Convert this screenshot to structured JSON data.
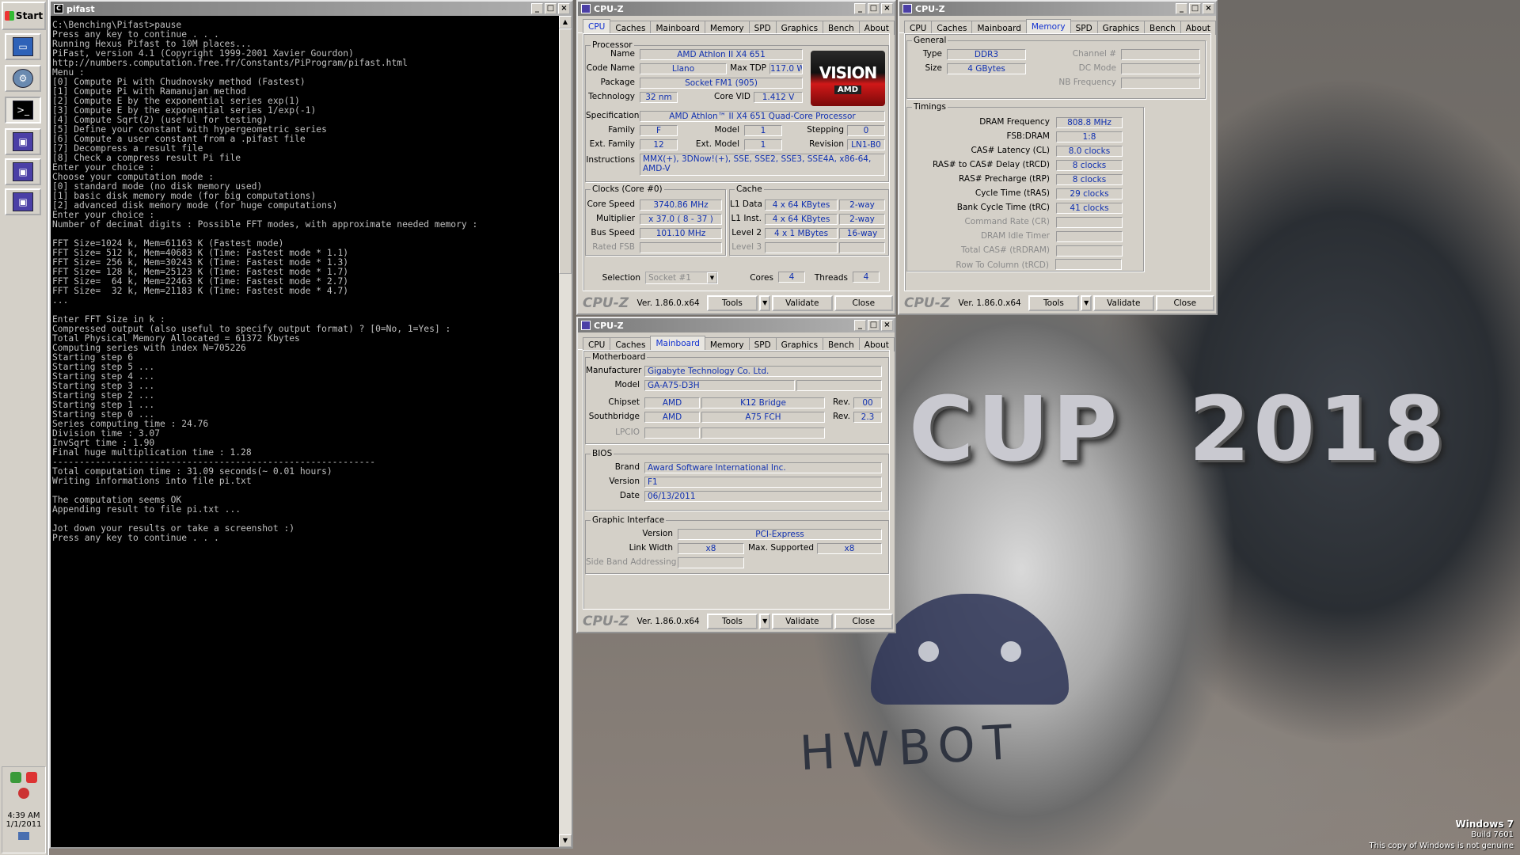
{
  "desktop": {
    "cup_text": "CUP  2018",
    "hwbot_text": "HWBOT",
    "os_name": "Windows 7",
    "os_build": "Build 7601",
    "os_notice": "This copy of Windows is not genuine"
  },
  "taskbar": {
    "start_label": "Start",
    "clock_time": "4:39 AM",
    "clock_date": "1/1/2011"
  },
  "console": {
    "title": "pifast",
    "lines": [
      "C:\\Benching\\Pifast>pause",
      "Press any key to continue . . .",
      "Running Hexus Pifast to 10M places...",
      "PiFast, version 4.1 (Copyright 1999-2001 Xavier Gourdon)",
      "http://numbers.computation.free.fr/Constants/PiProgram/pifast.html",
      "Menu :",
      "[0] Compute Pi with Chudnovsky method (Fastest)",
      "[1] Compute Pi with Ramanujan method",
      "[2] Compute E by the exponential series exp(1)",
      "[3] Compute E by the exponential series 1/exp(-1)",
      "[4] Compute Sqrt(2) (useful for testing)",
      "[5] Define your constant with hypergeometric series",
      "[6] Compute a user constant from a .pifast file",
      "[7] Decompress a result file",
      "[8] Check a compress result Pi file",
      "Enter your choice :",
      "Choose your computation mode :",
      "[0] standard mode (no disk memory used)",
      "[1] basic disk memory mode (for big computations)",
      "[2] advanced disk memory mode (for huge computations)",
      "Enter your choice :",
      "Number of decimal digits : Possible FFT modes, with approximate needed memory :",
      "",
      "FFT Size=1024 k, Mem=61163 K (Fastest mode)",
      "FFT Size= 512 k, Mem=40683 K (Time: Fastest mode * 1.1)",
      "FFT Size= 256 k, Mem=30243 K (Time: Fastest mode * 1.3)",
      "FFT Size= 128 k, Mem=25123 K (Time: Fastest mode * 1.7)",
      "FFT Size=  64 k, Mem=22463 K (Time: Fastest mode * 2.7)",
      "FFT Size=  32 k, Mem=21183 K (Time: Fastest mode * 4.7)",
      "...",
      "",
      "Enter FFT Size in k :",
      "Compressed output (also useful to specify output format) ? [0=No, 1=Yes] :",
      "Total Physical Memory Allocated = 61372 Kbytes",
      "Computing series with index N=705226",
      "Starting step 6",
      "Starting step 5 ...",
      "Starting step 4 ...",
      "Starting step 3 ...",
      "Starting step 2 ...",
      "Starting step 1 ...",
      "Starting step 0 ...",
      "Series computing time : 24.76",
      "Division time : 3.07",
      "InvSqrt time : 1.90",
      "Final huge multiplication time : 1.28",
      "------------------------------------------------------------",
      "Total computation time : 31.09 seconds(~ 0.01 hours)",
      "Writing informations into file pi.txt",
      "",
      "The computation seems OK",
      "Appending result to file pi.txt ...",
      "",
      "Jot down your results or take a screenshot :)",
      "Press any key to continue . . ."
    ]
  },
  "cpuz_common": {
    "title": "CPU-Z",
    "tabs": [
      "CPU",
      "Caches",
      "Mainboard",
      "Memory",
      "SPD",
      "Graphics",
      "Bench",
      "About"
    ],
    "logo": "CPU-Z",
    "version": "Ver. 1.86.0.x64",
    "tools": "Tools",
    "validate": "Validate",
    "close": "Close"
  },
  "cpu": {
    "group_processor": "Processor",
    "name_label": "Name",
    "name": "AMD Athlon II X4 651",
    "codename_label": "Code Name",
    "codename": "Llano",
    "maxtdp_label": "Max TDP",
    "maxtdp": "117.0 W",
    "package_label": "Package",
    "package": "Socket FM1 (905)",
    "technology_label": "Technology",
    "technology": "32 nm",
    "corevid_label": "Core VID",
    "corevid": "1.412 V",
    "spec_label": "Specification",
    "spec": "AMD Athlon™ II X4 651 Quad-Core Processor",
    "family_label": "Family",
    "family": "F",
    "model_label": "Model",
    "model": "1",
    "stepping_label": "Stepping",
    "stepping": "0",
    "extfamily_label": "Ext. Family",
    "extfamily": "12",
    "extmodel_label": "Ext. Model",
    "extmodel": "1",
    "revision_label": "Revision",
    "revision": "LN1-B0",
    "instr_label": "Instructions",
    "instr": "MMX(+), 3DNow!(+), SSE, SSE2, SSE3, SSE4A, x86-64, AMD-V",
    "badge_top": "VISION",
    "badge_bottom": "AMD",
    "group_clocks": "Clocks (Core #0)",
    "corespeed_label": "Core Speed",
    "corespeed": "3740.86 MHz",
    "multiplier_label": "Multiplier",
    "multiplier": "x 37.0 ( 8 - 37 )",
    "busspeed_label": "Bus Speed",
    "busspeed": "101.10 MHz",
    "ratedfsb_label": "Rated FSB",
    "group_cache": "Cache",
    "l1d_label": "L1 Data",
    "l1d": "4 x 64 KBytes",
    "l1d_way": "2-way",
    "l1i_label": "L1 Inst.",
    "l1i": "4 x 64 KBytes",
    "l1i_way": "2-way",
    "l2_label": "Level 2",
    "l2": "4 x 1 MBytes",
    "l2_way": "16-way",
    "l3_label": "Level 3",
    "selection_label": "Selection",
    "selection": "Socket #1",
    "cores_label": "Cores",
    "cores": "4",
    "threads_label": "Threads",
    "threads": "4"
  },
  "memory": {
    "group_general": "General",
    "type_label": "Type",
    "type": "DDR3",
    "size_label": "Size",
    "size": "4 GBytes",
    "channel_label": "Channel #",
    "dcmode_label": "DC Mode",
    "nbfreq_label": "NB Frequency",
    "group_timings": "Timings",
    "dram_label": "DRAM Frequency",
    "dram": "808.8 MHz",
    "fsbdram_label": "FSB:DRAM",
    "fsbdram": "1:8",
    "cl_label": "CAS# Latency (CL)",
    "cl": "8.0 clocks",
    "trcd_label": "RAS# to CAS# Delay (tRCD)",
    "trcd": "8 clocks",
    "trp_label": "RAS# Precharge (tRP)",
    "trp": "8 clocks",
    "tras_label": "Cycle Time (tRAS)",
    "tras": "29 clocks",
    "trc_label": "Bank Cycle Time (tRC)",
    "trc": "41 clocks",
    "cr_label": "Command Rate (CR)",
    "idle_label": "DRAM Idle Timer",
    "trdram_label": "Total CAS# (tRDRAM)",
    "trcd2_label": "Row To Column (tRCD)"
  },
  "mainboard": {
    "group_mb": "Motherboard",
    "manu_label": "Manufacturer",
    "manu": "Gigabyte Technology Co. Ltd.",
    "model_label": "Model",
    "model": "GA-A75-D3H",
    "chipset_label": "Chipset",
    "chipset_vendor": "AMD",
    "chipset_name": "K12 Bridge",
    "rev_label": "Rev.",
    "chipset_rev": "00",
    "south_label": "Southbridge",
    "south_vendor": "AMD",
    "south_name": "A75 FCH",
    "south_rev": "2.3",
    "lpcio_label": "LPCIO",
    "group_bios": "BIOS",
    "brand_label": "Brand",
    "brand": "Award Software International Inc.",
    "version_label": "Version",
    "version": "F1",
    "date_label": "Date",
    "date": "06/13/2011",
    "group_gi": "Graphic Interface",
    "gi_version_label": "Version",
    "gi_version": "PCI-Express",
    "linkwidth_label": "Link Width",
    "linkwidth": "x8",
    "maxsup_label": "Max. Supported",
    "maxsup": "x8",
    "sba_label": "Side Band Addressing"
  }
}
